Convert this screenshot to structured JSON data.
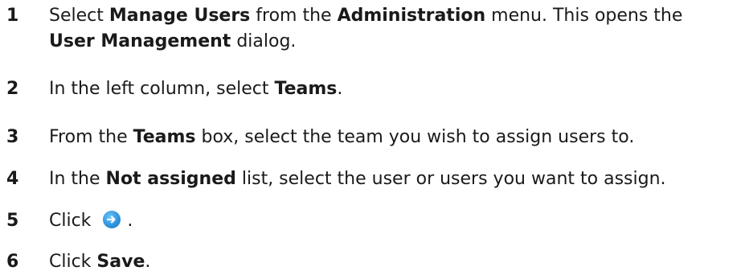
{
  "steps": [
    {
      "number": "1",
      "parts": [
        "Select ",
        "Manage Users",
        " from the ",
        "Administration",
        " menu. This opens the",
        "User Management",
        " dialog."
      ]
    },
    {
      "number": "2",
      "parts": [
        "In the left column, select ",
        "Teams",
        "."
      ]
    },
    {
      "number": "3",
      "parts": [
        "From the ",
        "Teams",
        " box, select the team you wish to assign users to."
      ]
    },
    {
      "number": "4",
      "parts": [
        "In the ",
        "Not assigned",
        " list, select the user or users you want to assign."
      ]
    },
    {
      "number": "5",
      "parts": [
        "Click ",
        "."
      ],
      "icon": "assign-arrow-icon"
    },
    {
      "number": "6",
      "parts": [
        "Click ",
        "Save",
        "."
      ]
    }
  ]
}
